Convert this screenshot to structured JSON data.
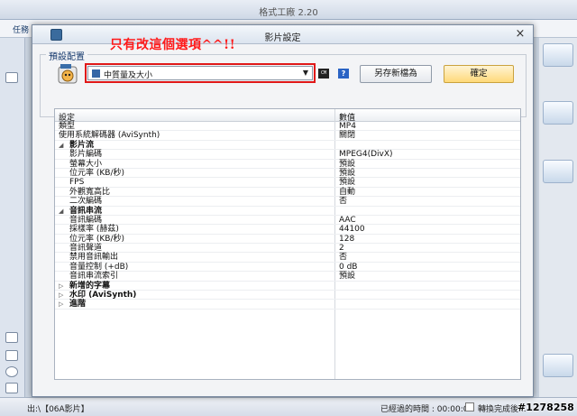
{
  "background_window": {
    "title": "格式工廠 2.20",
    "tab_label": "任務",
    "status": {
      "output_folder": "出:\\【06A影片】",
      "elapsed": "已經過的時間 : 00:00:00",
      "after_convert": "轉換完成後..."
    }
  },
  "watermark": "#1278258",
  "dialog": {
    "title": "影片設定",
    "close_glyph": "×",
    "preset_group_label": "預設配置",
    "annotation": "只有改這個選項^^!!",
    "preset_select": {
      "value": "中質量及大小",
      "arrow": "▼"
    },
    "icon_small": "CM",
    "help_glyph": "?",
    "save_as_button": "另存新檔為",
    "ok_button": "確定",
    "grid": {
      "header": {
        "setting": "設定",
        "value": "數值"
      },
      "rows": [
        {
          "kind": "plain",
          "name": "類型",
          "value": "MP4"
        },
        {
          "kind": "plain",
          "name": "使用系統解碼器 (AviSynth)",
          "value": "關閉"
        },
        {
          "kind": "cat",
          "name": "影片流",
          "expanded": true,
          "value": ""
        },
        {
          "kind": "child",
          "name": "影片編碼",
          "value": "MPEG4(DivX)"
        },
        {
          "kind": "child",
          "name": "螢幕大小",
          "value": "預設"
        },
        {
          "kind": "child",
          "name": "位元率 (KB/秒)",
          "value": "預設"
        },
        {
          "kind": "child",
          "name": "FPS",
          "value": "預設"
        },
        {
          "kind": "child",
          "name": "外觀寬高比",
          "value": "自動"
        },
        {
          "kind": "child",
          "name": "二次編碼",
          "value": "否"
        },
        {
          "kind": "cat",
          "name": "音訊串流",
          "expanded": true,
          "value": ""
        },
        {
          "kind": "child",
          "name": "音訊編碼",
          "value": "AAC"
        },
        {
          "kind": "child",
          "name": "採樣率 (赫茲)",
          "value": "44100"
        },
        {
          "kind": "child",
          "name": "位元率 (KB/秒)",
          "value": "128"
        },
        {
          "kind": "child",
          "name": "音訊聲道",
          "value": "2"
        },
        {
          "kind": "child",
          "name": "禁用音訊輸出",
          "value": "否"
        },
        {
          "kind": "child",
          "name": "音量控制 (+dB)",
          "value": "0 dB"
        },
        {
          "kind": "child",
          "name": "音訊串流索引",
          "value": "預設"
        },
        {
          "kind": "cat",
          "name": "新增的字幕",
          "expanded": false,
          "value": ""
        },
        {
          "kind": "cat",
          "name": "水印 (AviSynth)",
          "expanded": false,
          "value": ""
        },
        {
          "kind": "cat",
          "name": "進階",
          "expanded": false,
          "value": ""
        }
      ]
    }
  }
}
